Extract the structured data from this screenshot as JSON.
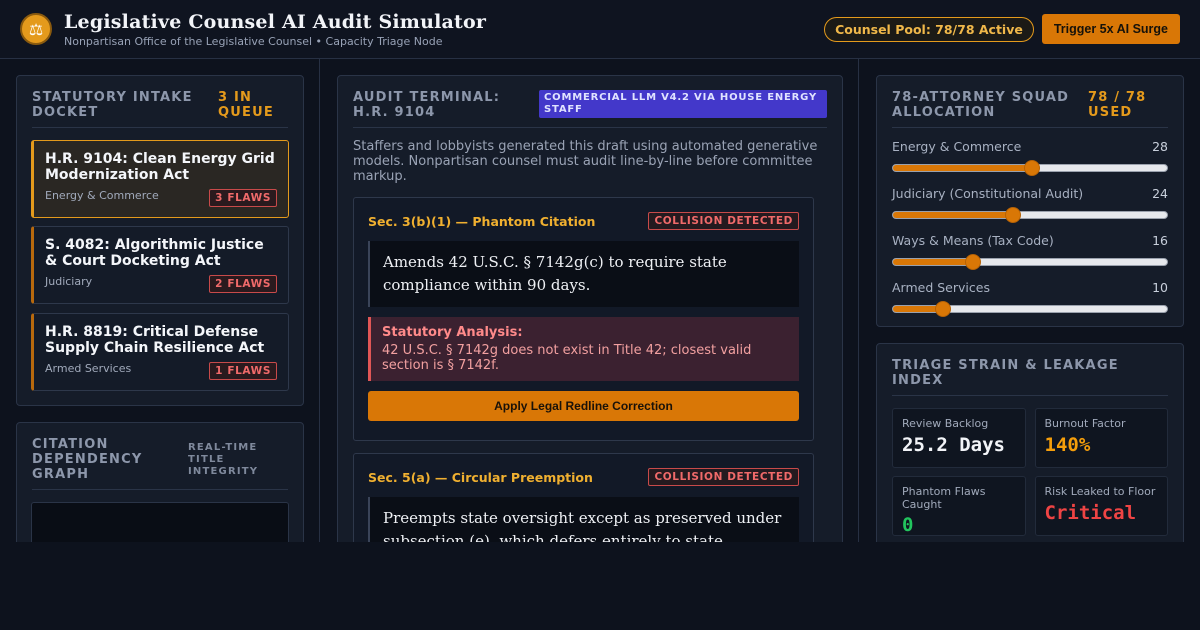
{
  "header": {
    "logo_glyph": "⚖",
    "title": "Legislative Counsel AI Audit Simulator",
    "subtitle": "Nonpartisan Office of the Legislative Counsel • Capacity Triage Node",
    "pool_badge": "Counsel Pool: 78/78 Active",
    "surge_button": "Trigger 5x AI Surge"
  },
  "docket": {
    "title": "Statutory Intake Docket",
    "count": "3 in queue",
    "bills": [
      {
        "title": "H.R. 9104: Clean Energy Grid Modernization Act",
        "committee": "Energy & Commerce",
        "flaws": "3 FLAWS"
      },
      {
        "title": "S. 4082: Algorithmic Justice & Court Docketing Act",
        "committee": "Judiciary",
        "flaws": "2 FLAWS"
      },
      {
        "title": "H.R. 8819: Critical Defense Supply Chain Resilience Act",
        "committee": "Armed Services",
        "flaws": "1 FLAWS"
      }
    ]
  },
  "graph": {
    "title": "Citation Dependency Graph",
    "subtitle": "Real-time title integrity"
  },
  "terminal": {
    "title": "Audit Terminal: H.R. 9104",
    "model_badge": "Commercial LLM v4.2 via House Energy Staff",
    "description": "Staffers and lobbyists generated this draft using automated generative models. Nonpartisan counsel must audit line-by-line before committee markup.",
    "issues": [
      {
        "title": "Sec. 3(b)(1) — Phantom Citation",
        "status": "COLLISION DETECTED",
        "clause": "Amends 42 U.S.C. § 7142g(c) to require state compliance within 90 days.",
        "analysis_label": "Statutory Analysis:",
        "analysis": "42 U.S.C. § 7142g does not exist in Title 42; closest valid section is § 7142f.",
        "action": "Apply Legal Redline Correction"
      },
      {
        "title": "Sec. 5(a) — Circular Preemption",
        "status": "COLLISION DETECTED",
        "clause": "Preempts state oversight except as preserved under subsection (e), which defers entirely to state standards."
      }
    ]
  },
  "allocation": {
    "title": "78-Attorney Squad Allocation",
    "count": "78 / 78 used",
    "max": 55,
    "items": [
      {
        "label": "Energy & Commerce",
        "value": 28
      },
      {
        "label": "Judiciary (Constitutional Audit)",
        "value": 24
      },
      {
        "label": "Ways & Means (Tax Code)",
        "value": 16
      },
      {
        "label": "Armed Services",
        "value": 10
      }
    ]
  },
  "triage": {
    "title": "Triage Strain & Leakage Index",
    "metrics": [
      {
        "label": "Review Backlog",
        "value": "25.2 Days",
        "color": "#f2f4f8"
      },
      {
        "label": "Burnout Factor",
        "value": "140%",
        "color": "#f59e0b"
      },
      {
        "label": "Phantom Flaws Caught",
        "value": "0",
        "color": "#22c55e"
      },
      {
        "label": "Risk Leaked to Floor",
        "value": "Critical",
        "color": "#ef4444"
      }
    ]
  }
}
